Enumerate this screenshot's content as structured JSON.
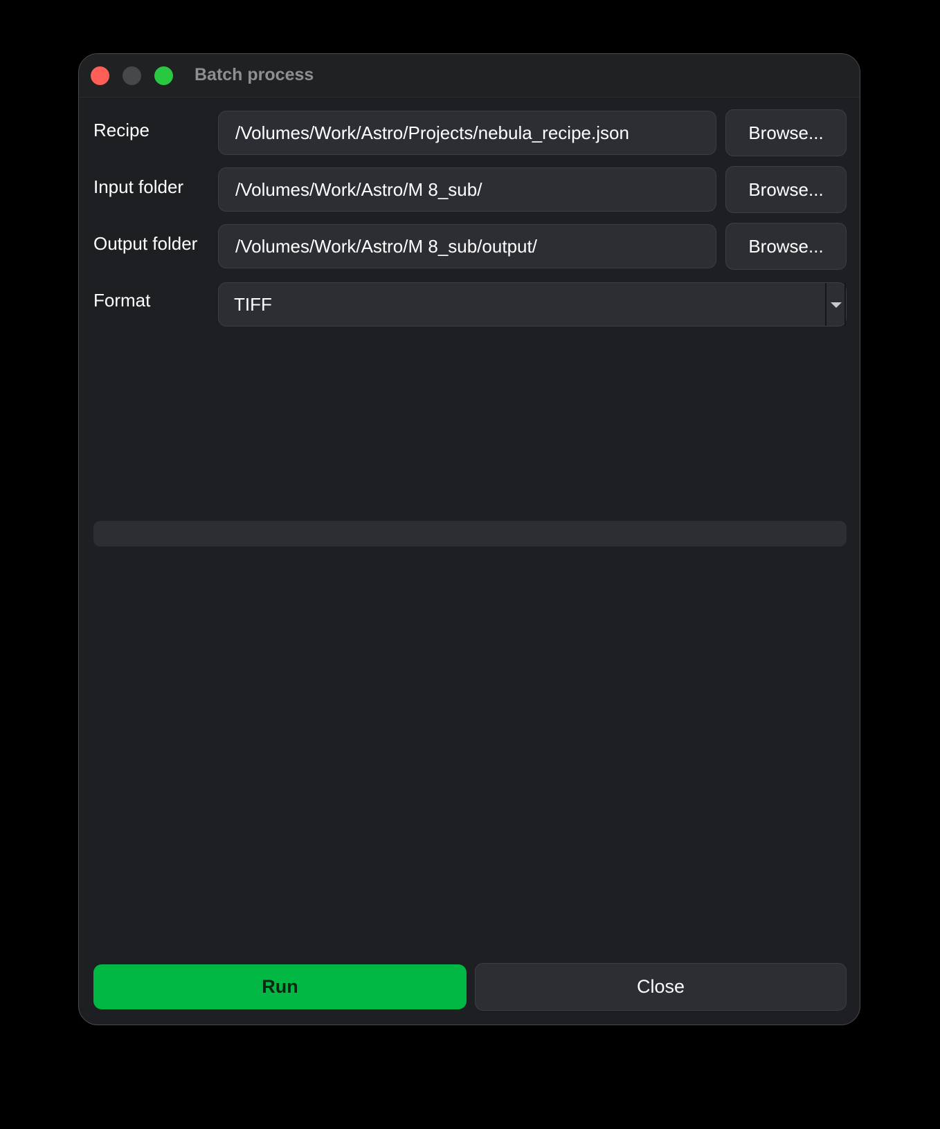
{
  "window": {
    "title": "Batch process",
    "controls": {
      "close": "close-button",
      "minimize": "minimize-button",
      "maximize": "maximize-button"
    }
  },
  "form": {
    "recipe": {
      "label": "Recipe",
      "value": "/Volumes/Work/Astro/Projects/nebula_recipe.json",
      "browse_label": "Browse..."
    },
    "input_folder": {
      "label": "Input folder",
      "value": "/Volumes/Work/Astro/M 8_sub/",
      "browse_label": "Browse..."
    },
    "output_folder": {
      "label": "Output folder",
      "value": "/Volumes/Work/Astro/M 8_sub/output/",
      "browse_label": "Browse..."
    },
    "format": {
      "label": "Format",
      "selected": "TIFF"
    }
  },
  "progress": {
    "percent": 0
  },
  "actions": {
    "run_label": "Run",
    "close_label": "Close"
  },
  "colors": {
    "accent": "#00b843",
    "background": "#1e1f22",
    "field": "#2c2e33",
    "traffic_close": "#ff5f57",
    "traffic_min": "#47484c",
    "traffic_max": "#28c840"
  }
}
